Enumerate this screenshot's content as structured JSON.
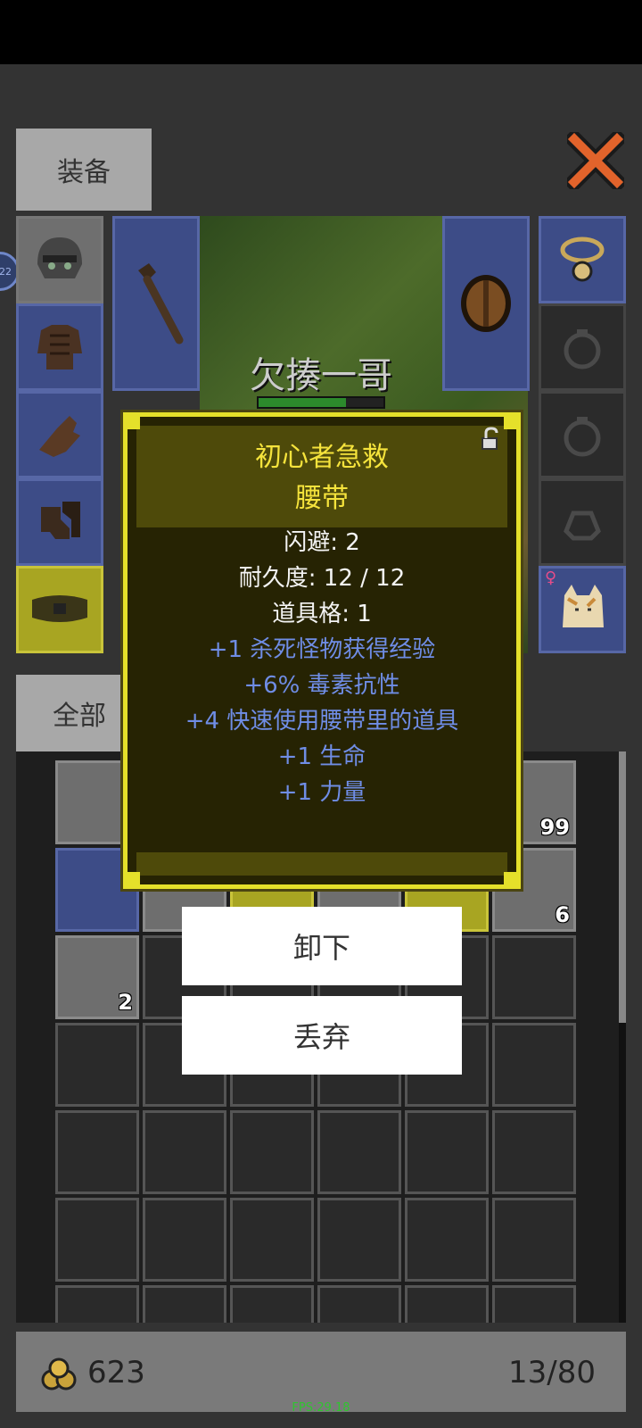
{
  "header": {
    "tab_equipment": "装备",
    "tab_all": "全部"
  },
  "hero": {
    "name": "欠揍一哥",
    "hp_fraction": 0.7,
    "level_badge": "22"
  },
  "item_popup": {
    "title": "初心者急救",
    "subtitle": "腰带",
    "stats": [
      "闪避: 2",
      "耐久度: 12 / 12",
      "道具格: 1"
    ],
    "bonuses": [
      "+1 杀死怪物获得经验",
      "+6% 毒素抗性",
      "+4 快速使用腰带里的道具",
      "+1 生命",
      "+1 力量"
    ]
  },
  "actions": {
    "unequip": "卸下",
    "discard": "丢弃"
  },
  "inventory": {
    "counts": [
      "99",
      "6",
      "2"
    ]
  },
  "footer": {
    "gold": "623",
    "capacity": "13/80"
  },
  "fps": "FPS:29.18",
  "colors": {
    "title_yellow": "#f5e33c",
    "bonus_blue": "#6f8de6",
    "popup_border": "#e5e02a"
  }
}
